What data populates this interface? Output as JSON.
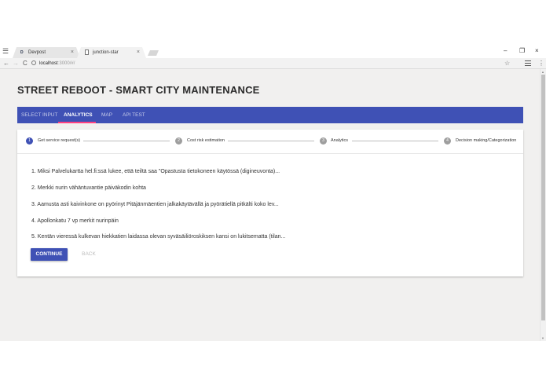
{
  "browser": {
    "menu_glyph": "☰",
    "tabs": [
      {
        "label": "Devpost",
        "favicon_text": "D",
        "close": "×"
      },
      {
        "label": "junction-star",
        "close": "×"
      }
    ],
    "window_controls": {
      "minimize": "–",
      "maximize": "❐",
      "close": "×"
    },
    "nav": {
      "back": "←",
      "forward": "→",
      "reload": "C"
    },
    "url": {
      "host": "localhost",
      "path": ":3000/#/"
    },
    "star": "☆",
    "kebab": "⋮"
  },
  "page": {
    "title": "STREET REBOOT - SMART CITY MAINTENANCE"
  },
  "nav_tabs": [
    "SELECT INPUT",
    "ANALYTICS",
    "MAP",
    "API TEST"
  ],
  "stepper": {
    "steps": [
      {
        "number": "1",
        "label": "Get service request(s)"
      },
      {
        "number": "2",
        "label": "Cost risk estimation"
      },
      {
        "number": "3",
        "label": "Analytics"
      },
      {
        "number": "4",
        "label": "Decision making/Categorization"
      }
    ]
  },
  "requests": [
    "1. Miksi Palvelukartta hel.fi:ssä lukee, että teiltä saa \"Opastusta tietokoneen käytössä (digineuvonta)...",
    "2. Merkki nurin vähäntuvantie päiväkodin kohta",
    "3. Aamusta asti kaivinkone on pyörinyt Pitäjänmäentien jalkakäytävällä ja pyörätiellä pitkälti koko lev...",
    "4. Apollonkatu 7 vp merkit nurinpäin",
    "5. Kentän vieressä kulkevan hiekkatien laidassa olevan syväsäiliöroskiksen kansi on lukitsematta (tilan..."
  ],
  "buttons": {
    "continue": "CONTINUE",
    "back": "BACK"
  },
  "scrollbar": {
    "up": "▲",
    "down": "▼"
  },
  "colors": {
    "primary": "#3f51b5",
    "accent": "#ff4081",
    "page_bg": "#f1f0ef"
  }
}
